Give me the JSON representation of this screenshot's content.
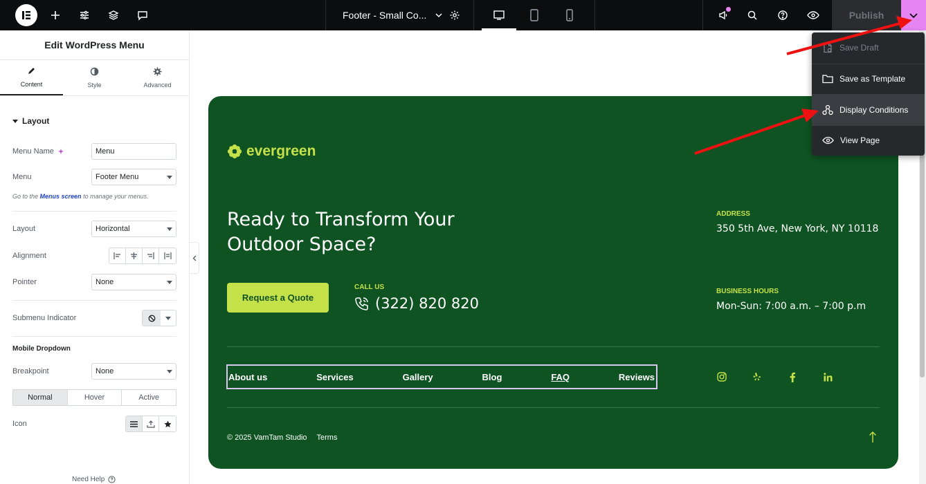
{
  "topbar": {
    "document_title": "Footer - Small Co...",
    "publish_label": "Publish"
  },
  "panel": {
    "title": "Edit WordPress Menu",
    "tabs": [
      {
        "label": "Content",
        "icon": "pencil-icon",
        "active": true
      },
      {
        "label": "Style",
        "icon": "half-circle-icon",
        "active": false
      },
      {
        "label": "Advanced",
        "icon": "gear-icon",
        "active": false
      }
    ],
    "section_layout": "Layout",
    "menu_name_label": "Menu Name",
    "menu_name_value": "Menu",
    "menu_label": "Menu",
    "menu_value": "Footer Menu",
    "note_prefix": "Go to the ",
    "note_link": "Menus screen",
    "note_suffix": " to manage your menus.",
    "layout_label": "Layout",
    "layout_value": "Horizontal",
    "alignment_label": "Alignment",
    "pointer_label": "Pointer",
    "pointer_value": "None",
    "submenu_indicator_label": "Submenu Indicator",
    "mobile_dropdown_heading": "Mobile Dropdown",
    "breakpoint_label": "Breakpoint",
    "breakpoint_value": "None",
    "state_tabs": [
      "Normal",
      "Hover",
      "Active"
    ],
    "icon_label": "Icon",
    "need_help": "Need Help"
  },
  "footer": {
    "brand": "evergreen",
    "headline": "Ready to Transform Your Outdoor Space?",
    "cta_label": "Request a Quote",
    "call_label": "CALL US",
    "phone": "(322) 820 820",
    "address_label": "ADDRESS",
    "address": "350 5th Ave, New York, NY 10118",
    "hours_label": "BUSINESS HOURS",
    "hours": "Mon-Sun: 7:00 a.m. – 7:00 p.m",
    "menu_items": [
      "About us",
      "Services",
      "Gallery",
      "Blog",
      "FAQ",
      "Reviews"
    ],
    "copyright": "© 2025 VamTam Studio",
    "terms": "Terms",
    "socials": [
      "instagram-icon",
      "yelp-icon",
      "facebook-icon",
      "linkedin-icon"
    ]
  },
  "dropdown": {
    "items": [
      {
        "label": "Save Draft",
        "icon": "document-icon",
        "disabled": true
      },
      {
        "label": "Save as Template",
        "icon": "folder-icon",
        "disabled": false
      },
      {
        "label": "Display Conditions",
        "icon": "conditions-icon",
        "disabled": false
      },
      {
        "label": "View Page",
        "icon": "eye-icon",
        "disabled": false
      }
    ]
  },
  "colors": {
    "footer_bg": "#0f5323",
    "accent_lime": "#c5e14a",
    "publish_caret": "#e685f2",
    "annotation_arrow": "#ee1111"
  }
}
